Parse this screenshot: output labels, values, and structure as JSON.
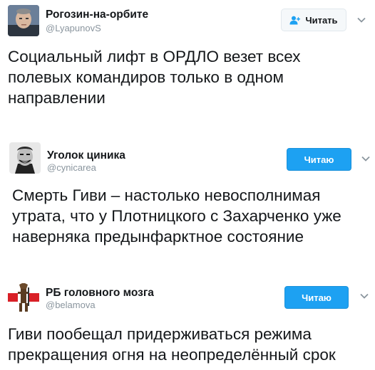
{
  "colors": {
    "accent": "#1da1f2",
    "handle": "#8a959e",
    "text": "#14171a"
  },
  "tweets": [
    {
      "name": "Рогозин-на-орбите",
      "handle": "@LyapunovS",
      "follow_label": "Читать",
      "follow_icon": "add-user-icon",
      "text": "Социальный лифт в ОРДЛО везет всех полевых командиров только в одном направлении"
    },
    {
      "name": "Уголок циника",
      "handle": "@cynicarea",
      "follow_label": "Читаю",
      "text": "Смерть Гиви – настолько невосполнимая утрата, что у Плотницкого с Захарченко уже наверняка предынфарктное состояние"
    },
    {
      "name": "РБ головного мозга",
      "handle": "@belamova",
      "follow_label": "Читаю",
      "text": "Гиви пообещал придерживаться режима прекращения огня на неопределённый срок"
    }
  ]
}
